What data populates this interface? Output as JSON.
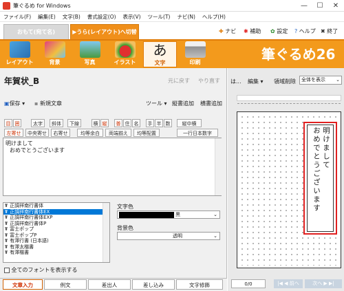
{
  "window": {
    "title": "筆ぐるめ for Windows"
  },
  "menu": [
    "ファイル(F)",
    "編集(E)",
    "文字(B)",
    "書式設定(O)",
    "表示(V)",
    "ツール(T)",
    "ナビ(N)",
    "ヘルプ(H)"
  ],
  "modes": {
    "front": "おもて(宛て名)",
    "back": "▶うら(レイアウト)へ切替"
  },
  "toplinks": {
    "navi": "ナビ",
    "assist": "補助",
    "settings": "設定",
    "help": "ヘルプ",
    "quit": "終了"
  },
  "ribbon": {
    "items": [
      "レイアウト",
      "背景",
      "写真",
      "イラスト",
      "文字",
      "印刷"
    ],
    "logo": "筆ぐるめ26"
  },
  "left": {
    "title": "年賀状_B",
    "undo": "元に戻す",
    "redo": "やり直す",
    "save": "保存",
    "new_text": "新規文章",
    "tool": "ツール",
    "vertical_add": "縦書追加",
    "horizontal_add": "横書追加",
    "fmt_row1": [
      "目",
      "囲",
      "太字",
      "斜体",
      "下線",
      "横",
      "縦",
      "普",
      "住",
      "名",
      "手",
      "半",
      "数",
      "縦中横"
    ],
    "fmt_row2": [
      "左寄せ",
      "中央寄せ",
      "右寄せ",
      "均等余白",
      "両端揃え",
      "均等配置",
      "一行日本数字"
    ],
    "text": [
      "明けまして",
      "おめでとうございます"
    ],
    "fonts": [
      "正調祥南行書体",
      "正調祥南行書体EX",
      "正調祥南行書体EXP",
      "正調祥南行書体P",
      "富士ポップ",
      "富士ポップP",
      "有澤行書 (日本語)",
      "有澤太楷書",
      "有澤楷書"
    ],
    "font_selected_index": 1,
    "show_all_fonts": "全てのフォントを表示する",
    "text_color_label": "文字色",
    "text_color_value": "黒",
    "bg_color_label": "背景色",
    "bg_color_value": "透明",
    "bottom_tabs": [
      "文章入力",
      "例文",
      "差出人",
      "差し込み",
      "文字修飾"
    ]
  },
  "right": {
    "ha": "は...",
    "edit": "編集",
    "area_delete": "領域削除",
    "zoom": "全体を表示",
    "page": "0/0",
    "prev": "前へ",
    "next": "次へ"
  },
  "colors": {
    "accent": "#f39a1c",
    "highlight": "#e02020"
  }
}
